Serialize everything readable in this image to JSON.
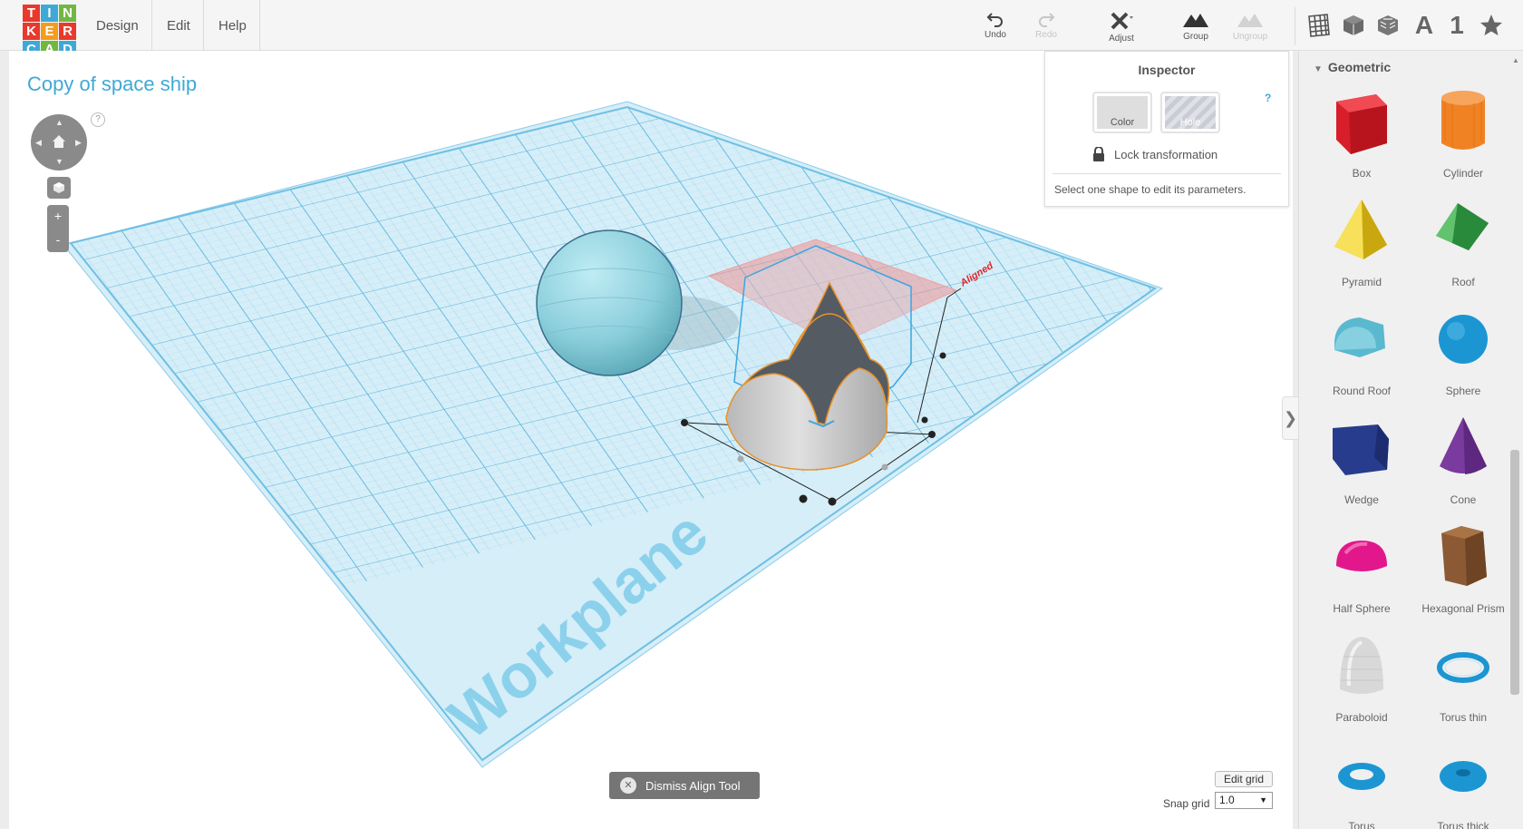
{
  "logo": {
    "letters": [
      "T",
      "I",
      "N",
      "K",
      "E",
      "R",
      "C",
      "A",
      "D"
    ],
    "colors": [
      "#e8392c",
      "#3fa9d6",
      "#73b743",
      "#e8392c",
      "#f39c1e",
      "#e8392c",
      "#3fa9d6",
      "#73b743",
      "#3fa9d6"
    ]
  },
  "menu": {
    "design": "Design",
    "edit": "Edit",
    "help": "Help"
  },
  "toolbar": {
    "undo": "Undo",
    "redo": "Redo",
    "adjust": "Adjust",
    "group": "Group",
    "ungroup": "Ungroup"
  },
  "view_buttons": {
    "text": "A",
    "number": "1"
  },
  "design_title": "Copy of space ship",
  "nav": {
    "help": "?",
    "zoom_in": "+",
    "zoom_out": "-"
  },
  "inspector": {
    "title": "Inspector",
    "color_label": "Color",
    "hole_label": "Hole",
    "help": "?",
    "lock_label": "Lock transformation",
    "hint": "Select one shape to edit its parameters."
  },
  "panel": {
    "heading": "Geometric",
    "shapes": [
      {
        "name": "Box",
        "icon": "box-icon",
        "color": "#d81e2a"
      },
      {
        "name": "Cylinder",
        "icon": "cylinder-icon",
        "color": "#f08224"
      },
      {
        "name": "Pyramid",
        "icon": "pyramid-icon",
        "color": "#f2cf1d"
      },
      {
        "name": "Roof",
        "icon": "roof-icon",
        "color": "#35a84a"
      },
      {
        "name": "Round Roof",
        "icon": "round-roof-icon",
        "color": "#5ab9cf"
      },
      {
        "name": "Sphere",
        "icon": "sphere-icon",
        "color": "#1c96d3"
      },
      {
        "name": "Wedge",
        "icon": "wedge-icon",
        "color": "#273c8c"
      },
      {
        "name": "Cone",
        "icon": "cone-icon",
        "color": "#7a3a9e"
      },
      {
        "name": "Half Sphere",
        "icon": "half-sphere-icon",
        "color": "#e2178c"
      },
      {
        "name": "Hexagonal Prism",
        "icon": "hexagonal-prism-icon",
        "color": "#8b5a34"
      },
      {
        "name": "Paraboloid",
        "icon": "paraboloid-icon",
        "color": "#d8d8d8"
      },
      {
        "name": "Torus thin",
        "icon": "torus-thin-icon",
        "color": "#1c96d3"
      },
      {
        "name": "Torus",
        "icon": "torus-icon",
        "color": "#1c96d3"
      },
      {
        "name": "Torus thick",
        "icon": "torus-thick-icon",
        "color": "#1c96d3"
      }
    ]
  },
  "workplane_label": "Workplane",
  "aligned_label": "Aligned",
  "dismiss_label": "Dismiss Align Tool",
  "edit_grid_label": "Edit grid",
  "snap": {
    "label": "Snap grid",
    "value": "1.0"
  }
}
